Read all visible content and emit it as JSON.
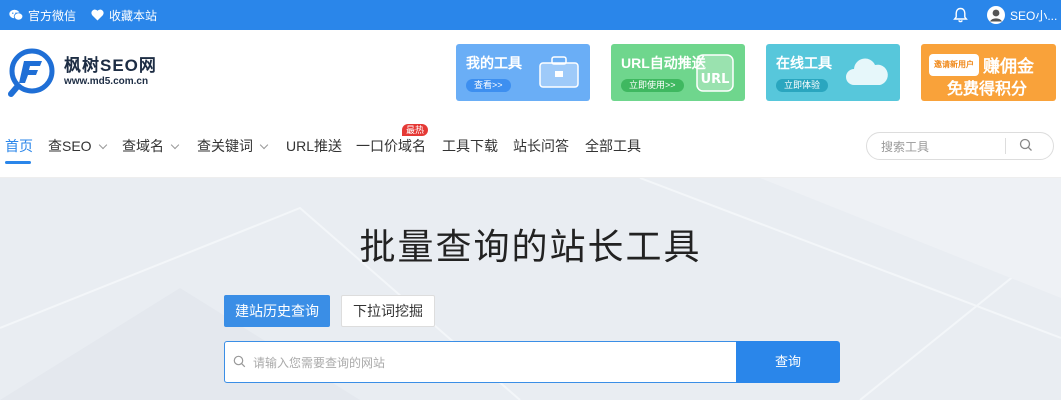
{
  "topbar": {
    "wechat_label": "官方微信",
    "favorite_label": "收藏本站",
    "user_name": "SEO小..."
  },
  "logo": {
    "name": "枫树SEO网",
    "url": "www.md5.com.cn"
  },
  "banners": [
    {
      "title": "我的工具",
      "button": "查看>>",
      "color": "#6aaef6",
      "button_color": "#3d8ff0"
    },
    {
      "title": "URL自动推送",
      "button": "立即使用>>",
      "color": "#6fd68d",
      "button_color": "#3fb860"
    },
    {
      "title": "在线工具",
      "button": "立即体验",
      "color": "#57c7db",
      "button_color": "#2aa6bf"
    },
    {
      "badge": "邀请新用户",
      "title": "赚佣金",
      "subtitle": "免费得积分",
      "color": "#f9a23a"
    }
  ],
  "nav": {
    "items": [
      "首页",
      "查SEO",
      "查域名",
      "查关键词",
      "URL推送",
      "一口价域名",
      "工具下载",
      "站长问答",
      "全部工具"
    ],
    "hot_badge": "最热",
    "search_placeholder": "搜索工具"
  },
  "hero": {
    "title": "批量查询的站长工具",
    "tabs": [
      "建站历史查询",
      "下拉词挖掘"
    ],
    "query_placeholder": "请输入您需要查询的网站",
    "query_button": "查询"
  },
  "colors": {
    "accent": "#2a86ea",
    "hot": "#e53935"
  },
  "icons": [
    "wechat-icon",
    "heart-icon",
    "bell-icon",
    "avatar",
    "search-icon"
  ]
}
